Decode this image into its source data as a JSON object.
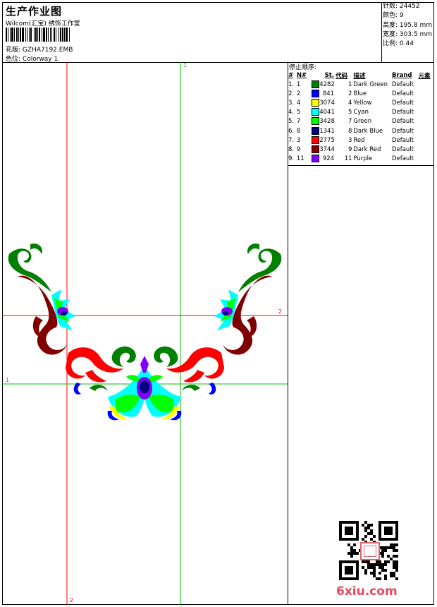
{
  "header": {
    "title": "生产作业图",
    "company": "Wilcom(汇宝) 绣饰工作室",
    "design_label": "花版:",
    "design_value": "GZHA7192.EMB",
    "colorway_label": "色位:",
    "colorway_value": "Colorway 1"
  },
  "stats": {
    "stitches_label": "针数:",
    "stitches_value": "24452",
    "colors_label": "颜色:",
    "colors_value": "9",
    "height_label": "高度:",
    "height_value": "195.8 mm",
    "width_label": "宽度:",
    "width_value": "303.5 mm",
    "scale_label": "比例:",
    "scale_value": "0.44"
  },
  "stop_sequence": {
    "title": "停止顺序:",
    "columns": [
      "#",
      "N#",
      "St.",
      "代码",
      "描述",
      "Brand",
      "元素"
    ],
    "rows": [
      {
        "num": "1.",
        "n": "1",
        "color": "#008000",
        "st": "4282",
        "code": "1",
        "desc": "Dark Green",
        "brand": "Default"
      },
      {
        "num": "2.",
        "n": "2",
        "color": "#0000ff",
        "st": "841",
        "code": "2",
        "desc": "Blue",
        "brand": "Default"
      },
      {
        "num": "3.",
        "n": "4",
        "color": "#ffff00",
        "st": "3074",
        "code": "4",
        "desc": "Yellow",
        "brand": "Default"
      },
      {
        "num": "4.",
        "n": "5",
        "color": "#00ffff",
        "st": "4041",
        "code": "5",
        "desc": "Cyan",
        "brand": "Default"
      },
      {
        "num": "5.",
        "n": "7",
        "color": "#00ff00",
        "st": "3428",
        "code": "7",
        "desc": "Green",
        "brand": "Default"
      },
      {
        "num": "6.",
        "n": "8",
        "color": "#000080",
        "st": "1341",
        "code": "8",
        "desc": "Dark Blue",
        "brand": "Default"
      },
      {
        "num": "7.",
        "n": "3",
        "color": "#ff0000",
        "st": "2775",
        "code": "3",
        "desc": "Red",
        "brand": "Default"
      },
      {
        "num": "8.",
        "n": "9",
        "color": "#800000",
        "st": "3744",
        "code": "9",
        "desc": "Dark Red",
        "brand": "Default"
      },
      {
        "num": "9.",
        "n": "11",
        "color": "#8000ff",
        "st": "924",
        "code": "11",
        "desc": "Purple",
        "brand": "Default"
      }
    ]
  },
  "guides": {
    "v1_label": "1",
    "v2_label": "2",
    "h1_label": "1",
    "h2_label": "2"
  },
  "colors": {
    "guide_red": "#ff0000",
    "guide_green": "#00c000"
  },
  "watermark": "6xiu.com",
  "qr_icon": "qr-code-icon",
  "seal_icon": "seal-stamp-icon"
}
